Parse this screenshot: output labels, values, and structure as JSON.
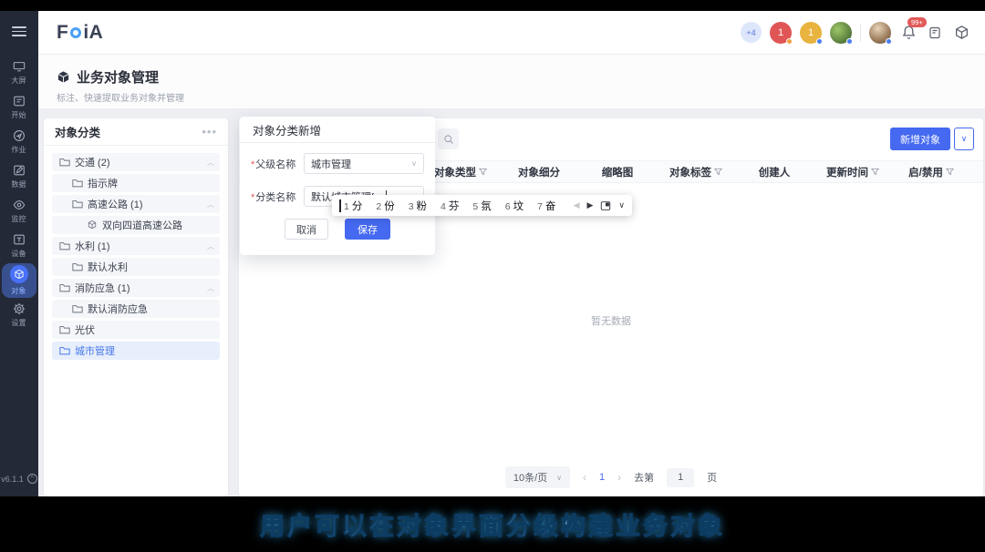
{
  "header": {
    "logo": "FOiA",
    "logo_f": "F",
    "logo_rest": "iA",
    "overflow_badge": "+4",
    "avatars": [
      {
        "initial": "1",
        "color": "#e05656"
      },
      {
        "initial": "1",
        "color": "#e8b33e"
      },
      {
        "type": "photo-green"
      },
      {
        "type": "photo-person"
      }
    ],
    "notification_count": "99+"
  },
  "sidebar": {
    "items": [
      {
        "label": "大屏"
      },
      {
        "label": "开始"
      },
      {
        "label": "作业"
      },
      {
        "label": "数据"
      },
      {
        "label": "监控"
      },
      {
        "label": "设备"
      },
      {
        "label": "对象",
        "active": true
      },
      {
        "label": "设置"
      }
    ],
    "version": "v6.1.1"
  },
  "page": {
    "title": "业务对象管理",
    "subtitle": "标注、快速提取业务对象并管理"
  },
  "tree": {
    "title": "对象分类",
    "items": [
      {
        "label": "交通 (2)",
        "level": 0,
        "expanded": true
      },
      {
        "label": "指示牌",
        "level": 1
      },
      {
        "label": "高速公路 (1)",
        "level": 1,
        "expanded": true
      },
      {
        "label": "双向四道高速公路",
        "level": 2,
        "icon": "object"
      },
      {
        "label": "水利 (1)",
        "level": 0,
        "expanded": true
      },
      {
        "label": "默认水利",
        "level": 1
      },
      {
        "label": "消防应急 (1)",
        "level": 0,
        "expanded": true
      },
      {
        "label": "默认消防应急",
        "level": 1
      },
      {
        "label": "光伏",
        "level": 0
      },
      {
        "label": "城市管理",
        "level": 0,
        "selected": true
      }
    ]
  },
  "modal": {
    "title": "对象分类新增",
    "parent_label": "父级名称",
    "parent_value": "城市管理",
    "name_label": "分类名称",
    "name_value": "默认城市管理fen",
    "cancel": "取消",
    "save": "保存"
  },
  "ime": {
    "candidates": [
      {
        "num": "1",
        "text": "分"
      },
      {
        "num": "2",
        "text": "份"
      },
      {
        "num": "3",
        "text": "粉"
      },
      {
        "num": "4",
        "text": "芬"
      },
      {
        "num": "5",
        "text": "氛"
      },
      {
        "num": "6",
        "text": "坟"
      },
      {
        "num": "7",
        "text": "奋"
      }
    ]
  },
  "table": {
    "add_button": "新增对象",
    "headers": [
      {
        "label": "对象类型",
        "filter": true
      },
      {
        "label": "对象细分",
        "filter": false
      },
      {
        "label": "缩略图",
        "filter": false
      },
      {
        "label": "对象标签",
        "filter": true
      },
      {
        "label": "创建人",
        "filter": false
      },
      {
        "label": "更新时间",
        "filter": true
      },
      {
        "label": "启/禁用",
        "filter": true
      }
    ],
    "empty_text": "暂无数据"
  },
  "pagination": {
    "page_size": "10条/页",
    "prev": "‹",
    "current": "1",
    "next": "›",
    "goto_prefix": "去第",
    "goto_value": "1",
    "goto_suffix": "页"
  },
  "caption": "用户可以在对象界面分级构建业务对象",
  "colors": {
    "primary": "#4569f0",
    "sidebar_bg": "#232936",
    "selected_row_bg": "#e7eefc",
    "caption_blue": "#9fdcff"
  }
}
